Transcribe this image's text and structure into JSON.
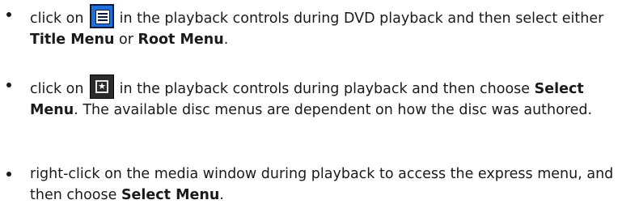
{
  "items": [
    {
      "pre": "click on",
      "icon": "title-menu-list-icon",
      "mid": " in the playback controls during DVD playback and then select either ",
      "bold1": "Title Menu",
      "or": " or ",
      "bold2": "Root Menu",
      "end": "."
    },
    {
      "pre": "click on",
      "icon": "select-menu-star-icon",
      "mid": " in the playback controls during playback and then choose ",
      "bold1": "Select Menu",
      "end": ". The available disc menus are dependent on how the disc was authored."
    },
    {
      "pre": "right-click on the media window during playback to access the express menu, and then choose ",
      "bold1": "Select Menu",
      "end": "."
    }
  ],
  "colors": {
    "text": "#1a1a1a",
    "list_icon_blue": "#1e6fd9",
    "star_icon_dark": "#2b2b2b"
  }
}
